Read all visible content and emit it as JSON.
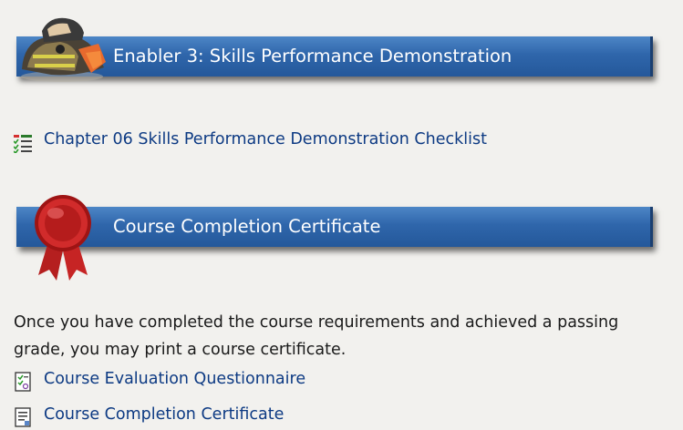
{
  "sections": [
    {
      "banner_title": "Enabler 3: Skills Performance Demonstration",
      "image": "firefighter-photo"
    },
    {
      "banner_title": "Course Completion Certificate",
      "image": "red-ribbon-seal-icon"
    }
  ],
  "links": {
    "checklist": "Chapter 06 Skills Performance Demonstration Checklist",
    "evaluation": "Course Evaluation Questionnaire",
    "certificate": "Course Completion Certificate"
  },
  "certificate_info": "Once you have completed the course requirements and achieved a passing grade, you may print a course certificate.",
  "colors": {
    "banner": "#2f66ab",
    "link": "#0d3a83",
    "background": "#f2f1ee"
  }
}
